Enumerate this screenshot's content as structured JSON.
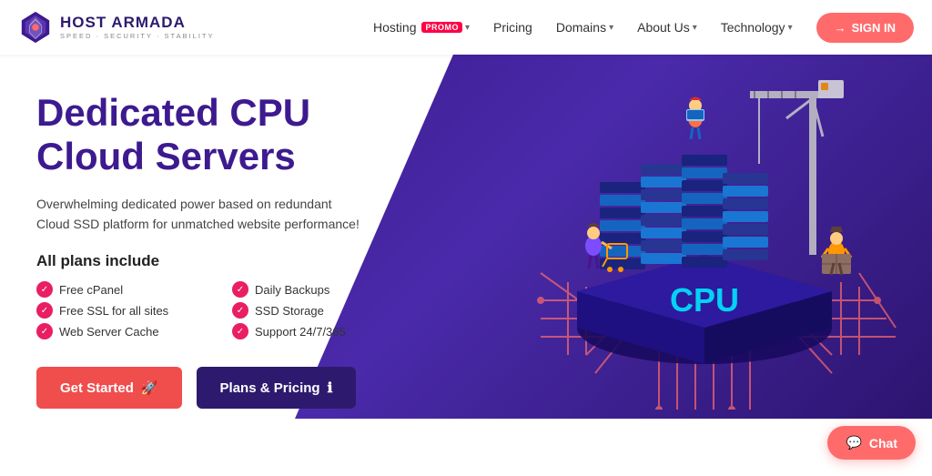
{
  "logo": {
    "main": "HOST ARMADA",
    "sub": "SPEED · SECURITY · STABILITY"
  },
  "nav": {
    "items": [
      {
        "id": "hosting",
        "label": "Hosting",
        "has_promo": true,
        "has_dropdown": true
      },
      {
        "id": "pricing",
        "label": "Pricing",
        "has_promo": false,
        "has_dropdown": false
      },
      {
        "id": "domains",
        "label": "Domains",
        "has_promo": false,
        "has_dropdown": true
      },
      {
        "id": "about",
        "label": "About Us",
        "has_promo": false,
        "has_dropdown": true
      },
      {
        "id": "technology",
        "label": "Technology",
        "has_promo": false,
        "has_dropdown": true
      }
    ],
    "signin": "SIGN IN",
    "promo_label": "PROMO"
  },
  "hero": {
    "title_line1": "Dedicated CPU",
    "title_line2": "Cloud Servers",
    "description": "Overwhelming dedicated power based on redundant Cloud SSD platform for unmatched website performance!",
    "all_plans_label": "All plans include",
    "features": [
      {
        "id": "cpanel",
        "text": "Free cPanel"
      },
      {
        "id": "backups",
        "text": "Daily Backups"
      },
      {
        "id": "ssl",
        "text": "Free SSL for all sites"
      },
      {
        "id": "ssd",
        "text": "SSD Storage"
      },
      {
        "id": "cache",
        "text": "Web Server Cache"
      },
      {
        "id": "support",
        "text": "Support 24/7/365"
      }
    ],
    "btn_get_started": "Get Started",
    "btn_plans_pricing": "Plans & Pricing"
  },
  "chat": {
    "label": "Chat"
  },
  "colors": {
    "primary_purple": "#3d1a8f",
    "accent_red": "#f04d4d",
    "promo_red": "#ff0044"
  }
}
